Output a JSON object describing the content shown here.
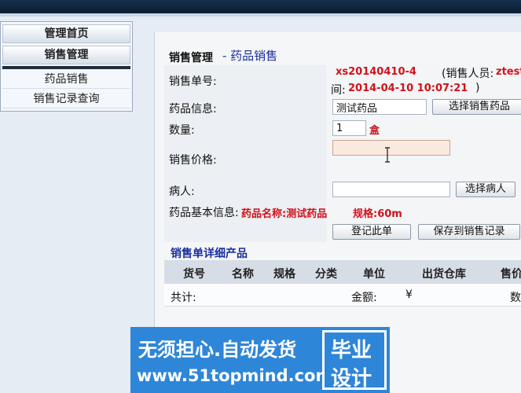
{
  "sidebar": {
    "headings": [
      "管理首页",
      "销售管理"
    ],
    "items": [
      "药品销售",
      "销售记录查询"
    ]
  },
  "main": {
    "title": "销售管理",
    "subtitle": "- 药品销售",
    "form": {
      "order_no_label": "销售单号:",
      "order_no": "xs20140410-4",
      "seller_prefix": "(销售人员:",
      "seller": "ztest",
      "time_prefix": "间:",
      "time": "2014-04-10 10:07:21",
      "time_suffix": ")",
      "drug_label": "药品信息:",
      "drug_value": "测试药品",
      "select_drug_button": "选择销售药品",
      "qty_label": "数量:",
      "qty_value": "1",
      "qty_unit": "盒",
      "price_label": "销售价格:",
      "price_value": "",
      "patient_label": "病人:",
      "patient_value": "",
      "select_patient_button": "选择病人",
      "basic_info_label": "药品基本信息:",
      "basic_info_name": "药品名称:测试药品",
      "basic_info_spec": "规格:60m",
      "register_button": "登记此单",
      "save_button": "保存到销售记录"
    },
    "detail": {
      "title": "销售单详细产品",
      "columns": [
        "货号",
        "名称",
        "规格",
        "分类",
        "单位",
        "出货仓库",
        "售价"
      ],
      "total_label": "共计:",
      "amount_label": "金额:",
      "amount_value": "¥",
      "count_label": "数"
    }
  },
  "watermark": {
    "line1": "无须担心.自动发货",
    "line2": "www.51topmind.com",
    "box_line1": "毕业",
    "box_line2": "设计"
  },
  "colors": {
    "topbar": "#0b1e33",
    "accent_blue": "#1a2e9e",
    "red_value": "#d0121b",
    "watermark_bg": "#2e86d9",
    "price_input_bg": "#fbe9e0"
  }
}
